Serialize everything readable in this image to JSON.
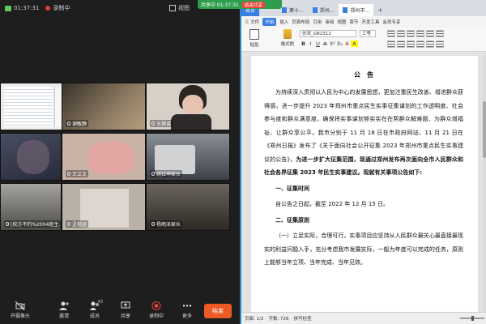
{
  "meeting": {
    "time": "01:37:31",
    "recording_label": "录制中",
    "view_label": "视图",
    "tiles": [
      {
        "label": "",
        "bg": "#ececec"
      },
      {
        "label": "谢敏静",
        "bg": "#7a6a57"
      },
      {
        "label": "王琪谣",
        "bg": "#d8d0c6"
      },
      {
        "label": "",
        "bg": "#3b3f52"
      },
      {
        "label": "王立文",
        "bg": "#b89a8e"
      },
      {
        "label": "姚钰坤家长",
        "bg": "#5c6168"
      },
      {
        "label": "[校方不约%2004班主…",
        "bg": "#6e6d68"
      },
      {
        "label": "孟楷涵",
        "bg": "#a79f96"
      },
      {
        "label": "杨雨泽家长",
        "bg": "#4f4b45"
      }
    ],
    "toolbar": {
      "camera": "开摄像头",
      "invite": "邀请",
      "members": "成员",
      "member_count": "43",
      "share": "共享",
      "record": "录制中",
      "more": "更多",
      "end": "结束"
    }
  },
  "share_banner": {
    "text": "共享中 01:37:31",
    "stop": "结束共享"
  },
  "wps": {
    "tabs": [
      {
        "label": "首页"
      },
      {
        "label": "第十..."
      },
      {
        "label": "郑州..."
      },
      {
        "label": "郑州市..."
      }
    ],
    "menu": [
      "三 文件",
      "开始",
      "插入",
      "页面布局",
      "引用",
      "审阅",
      "视图",
      "章节",
      "开发工具",
      "会员专享"
    ],
    "ribbon": {
      "paste": "粘贴",
      "format_painter": "格式刷",
      "font_name": "仿宋_GB2312",
      "font_size": "三号",
      "font_buttons": [
        "B",
        "I",
        "U",
        "A",
        "X²",
        "X₂",
        "A",
        "A"
      ]
    },
    "document": {
      "title": "公　告",
      "p1": "为持续深入贯彻以人民为中心的发展思想，更加注重民生改善、增进群众获得感，进一步提升 2023 年郑州市重点民生实事征集谋划的工作透明度、社会参与度和群众满意度，确保将实事谋划够实实在在帮群众解难题、为群众增福祉、让群众享公平。我市分别于 11 月 18 日在市政府网站、11 月 21 日在《郑州日报》发布了《关于面向社会公开征集 2023 年郑州市重点民生实事建议的公告》，",
      "p1_bold": "为进一步扩大征集范围，现通过郑州发布再次面向全市人民群众和社会各界征集 2023 年民生实事建议。现就有关事项公告如下:",
      "h1": "一、征集时间",
      "p2": "自公告之日起，截至 2022 年 12 月 15 日。",
      "h2": "二、征集原则",
      "p3": "（一）立足实际，合理可行。实事项目应坚持从人民群众最关心最直接最现实的利益问题入手，充分考虑我市发展实际，一般为年度可以完成的任务，原则上能够当年立项、当年完成、当年见效。"
    },
    "status": {
      "page": "页面: 1/2",
      "words": "字数: 726",
      "spell": "拼写检查"
    }
  }
}
